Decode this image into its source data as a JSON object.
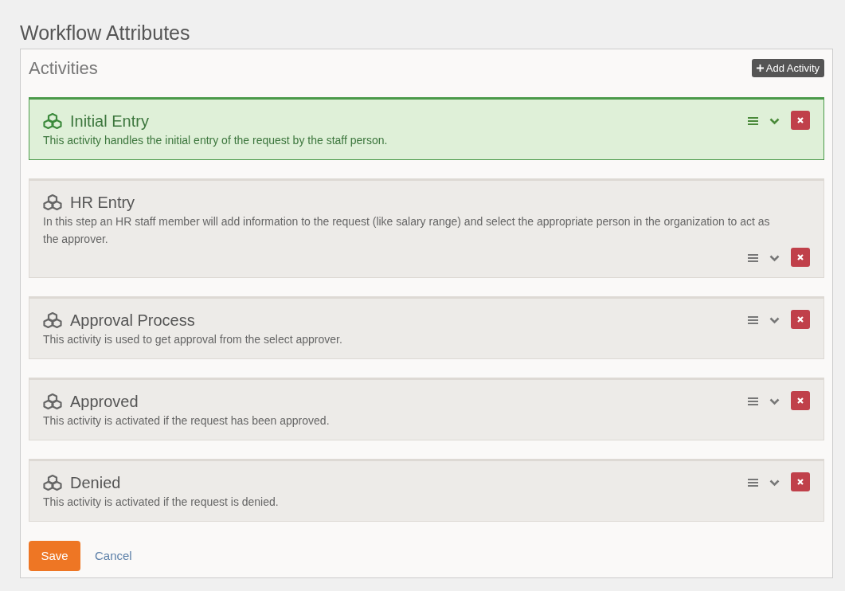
{
  "page_title": "Workflow Attributes",
  "panel": {
    "title": "Activities",
    "add_button": "Add Activity"
  },
  "activities": [
    {
      "name": "Initial Entry",
      "description": "This activity handles the initial entry of the request by the staff person.",
      "selected": true
    },
    {
      "name": "HR Entry",
      "description": "In this step an HR staff member will add information to the request (like salary range) and select the appropriate person in the organization to act as the approver.",
      "selected": false
    },
    {
      "name": "Approval Process",
      "description": "This activity is used to get approval from the select approver.",
      "selected": false
    },
    {
      "name": "Approved",
      "description": "This activity is activated if the request has been approved.",
      "selected": false
    },
    {
      "name": "Denied",
      "description": "This activity is activated if the request is denied.",
      "selected": false
    }
  ],
  "buttons": {
    "save": "Save",
    "cancel": "Cancel"
  }
}
